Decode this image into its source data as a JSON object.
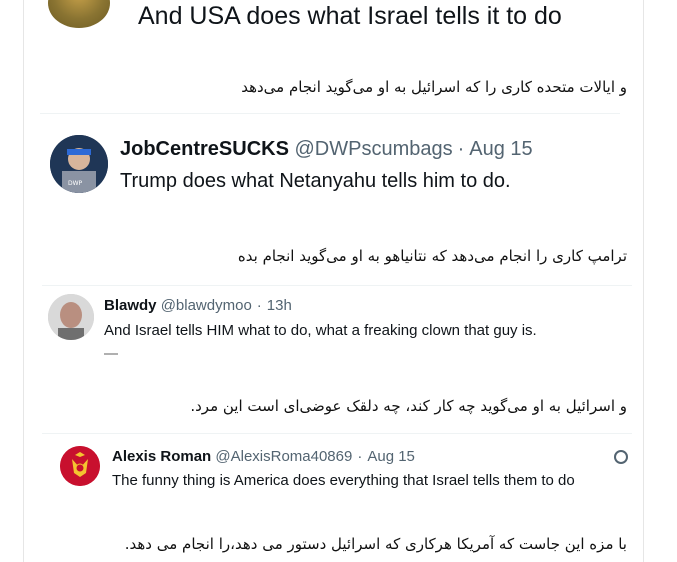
{
  "top_tweet": {
    "body": "And USA does what Israel tells it to do"
  },
  "translations": {
    "t1": "و ایالات متحده کاری را که اسرائیل به او می‌گوید انجام می‌دهد",
    "t2": "ترامپ کاری را انجام می‌دهد که نتانیاهو به او می‌گوید انجام بده",
    "t3": "و اسرائیل به او می‌گوید چه کار کند، چه دلقک عوضی‌ای است این مرد.",
    "t4": "با مزه این جاست که آمریکا هرکاری که اسرائیل دستور می دهد،را انجام می دهد."
  },
  "tweets": [
    {
      "name": "JobCentreSUCKS",
      "handle": "@DWPscumbags",
      "sep": "·",
      "date": "Aug 15",
      "body": "Trump does what Netanyahu tells him to do."
    },
    {
      "name": "Blawdy",
      "handle": "@blawdymoo",
      "sep": "·",
      "date": "13h",
      "body": "And Israel tells HIM what to do, what a freaking clown that guy is."
    },
    {
      "name": "Alexis Roman",
      "handle": "@AlexisRoma40869",
      "sep": "·",
      "date": "Aug 15",
      "body": "The funny thing is America does everything that Israel tells them to do"
    }
  ],
  "colors": {
    "text": "#0f1419",
    "muted": "#536471",
    "divider": "#eff3f4"
  },
  "icons": [
    "avatar-icon",
    "grok-icon",
    "emoji-icon"
  ]
}
